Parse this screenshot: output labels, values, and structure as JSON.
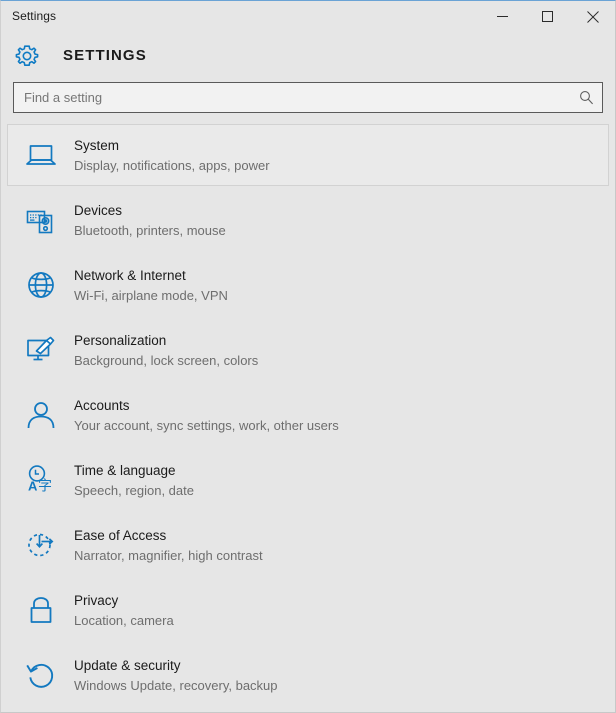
{
  "window": {
    "title": "Settings",
    "accent_color": "#0078d7",
    "background_color": "#e6e6e6",
    "controls": {
      "minimize": "Minimize",
      "maximize": "Maximize",
      "close": "Close"
    }
  },
  "header": {
    "icon": "gear-icon",
    "title": "SETTINGS"
  },
  "search": {
    "placeholder": "Find a setting",
    "value": "",
    "icon": "search-icon"
  },
  "settings": {
    "items": [
      {
        "title": "System",
        "subtitle": "Display, notifications, apps, power",
        "icon": "laptop-icon",
        "selected": true
      },
      {
        "title": "Devices",
        "subtitle": "Bluetooth, printers, mouse",
        "icon": "devices-icon",
        "selected": false
      },
      {
        "title": "Network & Internet",
        "subtitle": "Wi-Fi, airplane mode, VPN",
        "icon": "globe-icon",
        "selected": false
      },
      {
        "title": "Personalization",
        "subtitle": "Background, lock screen, colors",
        "icon": "monitor-brush-icon",
        "selected": false
      },
      {
        "title": "Accounts",
        "subtitle": "Your account, sync settings, work, other users",
        "icon": "person-icon",
        "selected": false
      },
      {
        "title": "Time & language",
        "subtitle": "Speech, region, date",
        "icon": "clock-language-icon",
        "selected": false
      },
      {
        "title": "Ease of Access",
        "subtitle": "Narrator, magnifier, high contrast",
        "icon": "ease-of-access-icon",
        "selected": false
      },
      {
        "title": "Privacy",
        "subtitle": "Location, camera",
        "icon": "lock-icon",
        "selected": false
      },
      {
        "title": "Update & security",
        "subtitle": "Windows Update, recovery, backup",
        "icon": "refresh-icon",
        "selected": false
      }
    ]
  }
}
